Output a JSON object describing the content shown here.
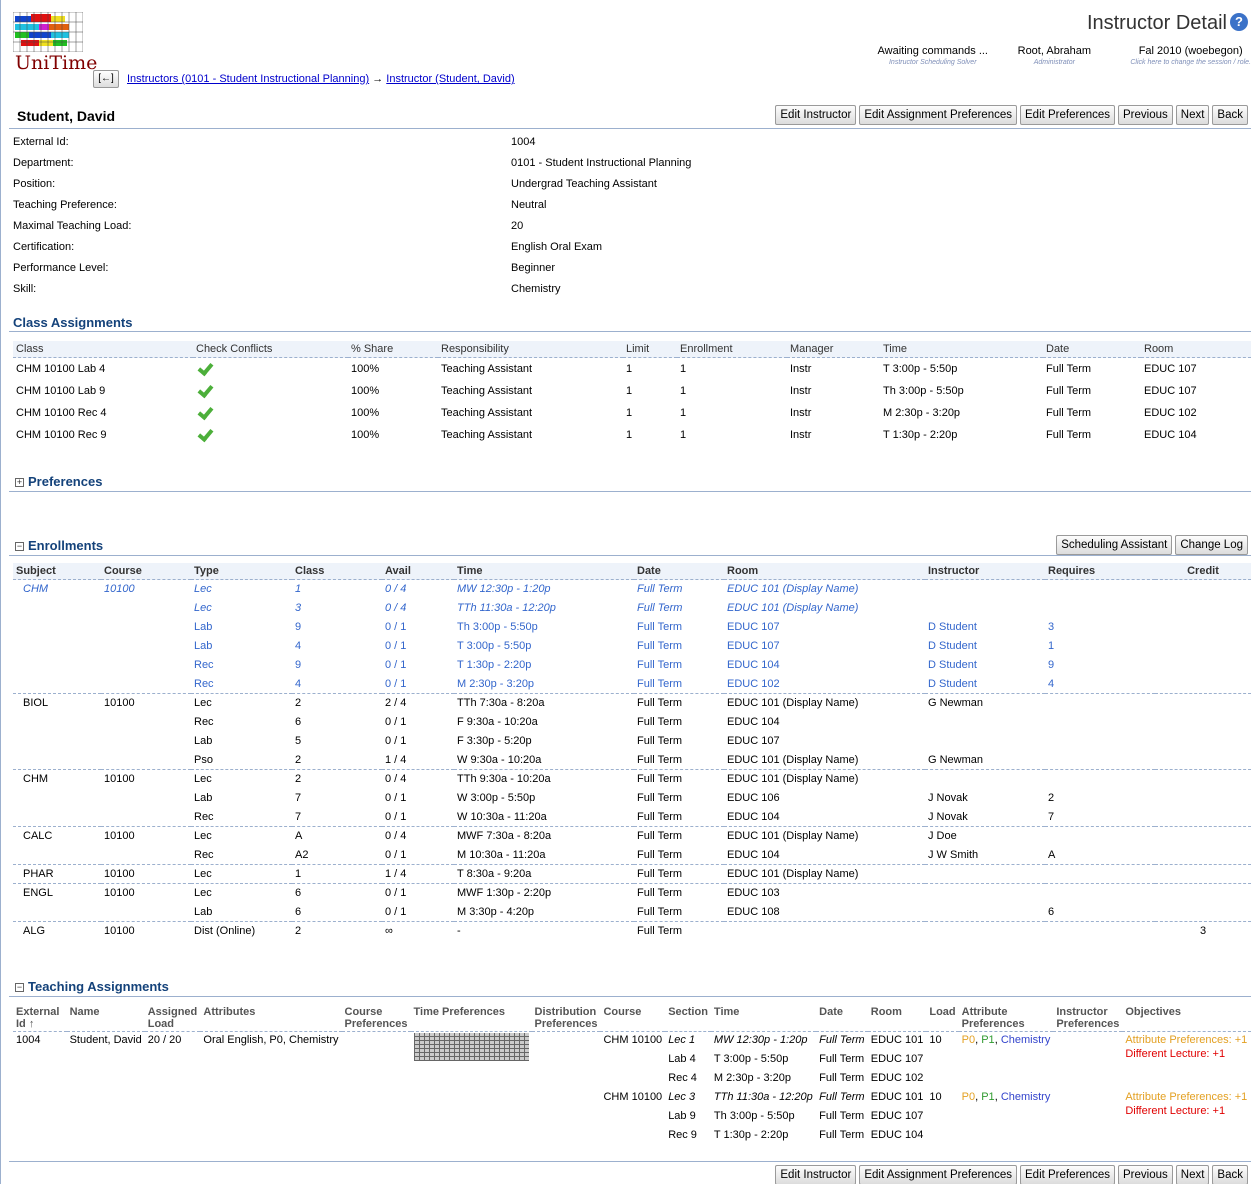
{
  "header": {
    "app_name": "UniTime",
    "title": "Instructor Detail",
    "help_icon": "?",
    "back_arrow": "[←]",
    "breadcrumb": [
      {
        "label": "Instructors (0101 - Student Instructional Planning)"
      },
      {
        "label": "Instructor (Student, David)"
      }
    ],
    "breadcrumb_sep": "→",
    "status": {
      "label": "Awaiting commands ...",
      "sub": "Instructor Scheduling Solver"
    },
    "user": {
      "label": "Root, Abraham",
      "sub": "Administrator"
    },
    "session": {
      "label": "Fal 2010 (woebegon)",
      "sub": "Click here to change the session / role."
    }
  },
  "buttons": {
    "edit_instructor": "Edit Instructor",
    "edit_assignment_prefs": "Edit Assignment Preferences",
    "edit_prefs": "Edit Preferences",
    "previous": "Previous",
    "next": "Next",
    "back": "Back"
  },
  "instructor": {
    "name": "Student, David",
    "fields": [
      {
        "label": "External Id:",
        "value": "1004"
      },
      {
        "label": "Department:",
        "value": "0101 - Student Instructional Planning"
      },
      {
        "label": "Position:",
        "value": "Undergrad Teaching Assistant"
      },
      {
        "label": "Teaching Preference:",
        "value": "Neutral"
      },
      {
        "label": "Maximal Teaching Load:",
        "value": "20"
      },
      {
        "label": "Certification:",
        "value": "English Oral Exam"
      },
      {
        "label": "Performance Level:",
        "value": "Beginner"
      },
      {
        "label": "Skill:",
        "value": "Chemistry"
      }
    ]
  },
  "class_assignments": {
    "title": "Class Assignments",
    "columns": [
      "Class",
      "Check Conflicts",
      "% Share",
      "Responsibility",
      "Limit",
      "Enrollment",
      "Manager",
      "Time",
      "Date",
      "Room"
    ],
    "rows": [
      [
        "CHM 10100 Lab 4",
        "",
        "100%",
        "Teaching Assistant",
        "1",
        "1",
        "Instr",
        "T 3:00p - 5:50p",
        "Full Term",
        "EDUC 107"
      ],
      [
        "CHM 10100 Lab 9",
        "",
        "100%",
        "Teaching Assistant",
        "1",
        "1",
        "Instr",
        "Th 3:00p - 5:50p",
        "Full Term",
        "EDUC 107"
      ],
      [
        "CHM 10100 Rec 4",
        "",
        "100%",
        "Teaching Assistant",
        "1",
        "1",
        "Instr",
        "M 2:30p - 3:20p",
        "Full Term",
        "EDUC 102"
      ],
      [
        "CHM 10100 Rec 9",
        "",
        "100%",
        "Teaching Assistant",
        "1",
        "1",
        "Instr",
        "T 1:30p - 2:20p",
        "Full Term",
        "EDUC 104"
      ]
    ]
  },
  "preferences": {
    "title": "Preferences",
    "toggle": "+"
  },
  "enrollments": {
    "title": "Enrollments",
    "toggle": "−",
    "scheduling_assistant": "Scheduling Assistant",
    "change_log": "Change Log",
    "columns": [
      "Subject",
      "Course",
      "Type",
      "Class",
      "Avail",
      "Time",
      "Date",
      "Room",
      "Instructor",
      "Requires",
      "Credit"
    ],
    "rows": [
      [
        "CHM",
        "10100",
        "Lec",
        "1",
        "0 / 4",
        "MW 12:30p - 1:20p",
        "Full Term",
        "EDUC 101 (Display Name)",
        "",
        "",
        ""
      ],
      [
        "",
        "",
        "Lec",
        "3",
        "0 / 4",
        "TTh 11:30a - 12:20p",
        "Full Term",
        "EDUC 101 (Display Name)",
        "",
        "",
        ""
      ],
      [
        "",
        "",
        "Lab",
        "9",
        "0 / 1",
        "Th 3:00p - 5:50p",
        "Full Term",
        "EDUC 107",
        "D Student",
        "3",
        ""
      ],
      [
        "",
        "",
        "Lab",
        "4",
        "0 / 1",
        "T 3:00p - 5:50p",
        "Full Term",
        "EDUC 107",
        "D Student",
        "1",
        ""
      ],
      [
        "",
        "",
        "Rec",
        "9",
        "0 / 1",
        "T 1:30p - 2:20p",
        "Full Term",
        "EDUC 104",
        "D Student",
        "9",
        ""
      ],
      [
        "",
        "",
        "Rec",
        "4",
        "0 / 1",
        "M 2:30p - 3:20p",
        "Full Term",
        "EDUC 102",
        "D Student",
        "4",
        ""
      ],
      [
        "BIOL",
        "10100",
        "Lec",
        "2",
        "2 / 4",
        "TTh 7:30a - 8:20a",
        "Full Term",
        "EDUC 101 (Display Name)",
        "G Newman",
        "",
        ""
      ],
      [
        "",
        "",
        "Rec",
        "6",
        "0 / 1",
        "F 9:30a - 10:20a",
        "Full Term",
        "EDUC 104",
        "",
        "",
        ""
      ],
      [
        "",
        "",
        "Lab",
        "5",
        "0 / 1",
        "F 3:30p - 5:20p",
        "Full Term",
        "EDUC 107",
        "",
        "",
        ""
      ],
      [
        "",
        "",
        "Pso",
        "2",
        "1 / 4",
        "W 9:30a - 10:20a",
        "Full Term",
        "EDUC 101 (Display Name)",
        "G Newman",
        "",
        ""
      ],
      [
        "CHM",
        "10100",
        "Lec",
        "2",
        "0 / 4",
        "TTh 9:30a - 10:20a",
        "Full Term",
        "EDUC 101 (Display Name)",
        "",
        "",
        ""
      ],
      [
        "",
        "",
        "Lab",
        "7",
        "0 / 1",
        "W 3:00p - 5:50p",
        "Full Term",
        "EDUC 106",
        "J Novak",
        "2",
        ""
      ],
      [
        "",
        "",
        "Rec",
        "7",
        "0 / 1",
        "W 10:30a - 11:20a",
        "Full Term",
        "EDUC 104",
        "J Novak",
        "7",
        ""
      ],
      [
        "CALC",
        "10100",
        "Lec",
        "A",
        "0 / 4",
        "MWF 7:30a - 8:20a",
        "Full Term",
        "EDUC 101 (Display Name)",
        "J Doe",
        "",
        ""
      ],
      [
        "",
        "",
        "Rec",
        "A2",
        "0 / 1",
        "M 10:30a - 11:20a",
        "Full Term",
        "EDUC 104",
        "J W Smith",
        "A",
        ""
      ],
      [
        "PHAR",
        "10100",
        "Lec",
        "1",
        "1 / 4",
        "T 8:30a - 9:20a",
        "Full Term",
        "EDUC 101 (Display Name)",
        "",
        "",
        ""
      ],
      [
        "ENGL",
        "10100",
        "Lec",
        "6",
        "0 / 1",
        "MWF 1:30p - 2:20p",
        "Full Term",
        "EDUC 103",
        "",
        "",
        ""
      ],
      [
        "",
        "",
        "Lab",
        "6",
        "0 / 1",
        "M 3:30p - 4:20p",
        "Full Term",
        "EDUC 108",
        "",
        "6",
        ""
      ],
      [
        "ALG",
        "10100",
        "Dist (Online)",
        "2",
        "∞",
        "-",
        "Full Term",
        "",
        "",
        "",
        "3"
      ]
    ]
  },
  "teaching_assignments": {
    "title": "Teaching Assignments",
    "toggle": "−",
    "columns": [
      "External Id ↑",
      "Name",
      "Assigned Load",
      "Attributes",
      "Course Preferences",
      "Time Preferences",
      "Distribution Preferences",
      "Course",
      "Section",
      "Time",
      "Date",
      "Room",
      "Load",
      "Attribute Preferences",
      "Instructor Preferences",
      "Objectives"
    ],
    "instructor": {
      "external_id": "1004",
      "name": "Student, David",
      "assigned_load": "20 / 20",
      "attributes": "Oral English, P0, Chemistry"
    },
    "assignments": [
      {
        "course": "CHM 10100",
        "load": "10",
        "sections": [
          {
            "section": "Lec 1",
            "time": "MW 12:30p - 1:20p",
            "date": "Full Term",
            "room": "EDUC 101",
            "italic": true
          },
          {
            "section": "Lab 4",
            "time": "T 3:00p - 5:50p",
            "date": "Full Term",
            "room": "EDUC 107"
          },
          {
            "section": "Rec 4",
            "time": "M 2:30p - 3:20p",
            "date": "Full Term",
            "room": "EDUC 102"
          }
        ],
        "attr_prefs": [
          "P0",
          ", ",
          "P1",
          ", ",
          "Chemistry"
        ],
        "objectives": [
          "Attribute Preferences: +1",
          "Different Lecture: +1"
        ]
      },
      {
        "course": "CHM 10100",
        "load": "10",
        "sections": [
          {
            "section": "Lec 3",
            "time": "TTh 11:30a - 12:20p",
            "date": "Full Term",
            "room": "EDUC 101",
            "italic": true
          },
          {
            "section": "Lab 9",
            "time": "Th 3:00p - 5:50p",
            "date": "Full Term",
            "room": "EDUC 107"
          },
          {
            "section": "Rec 9",
            "time": "T 1:30p - 2:20p",
            "date": "Full Term",
            "room": "EDUC 104"
          }
        ],
        "attr_prefs": [
          "P0",
          ", ",
          "P1",
          ", ",
          "Chemistry"
        ],
        "objectives": [
          "Attribute Preferences: +1",
          "Different Lecture: +1"
        ]
      }
    ]
  },
  "colors": {
    "link": "#0000cc",
    "current_row": "#3366cc",
    "section_border": "#9cb0ce",
    "pref_orange": "#e3a022",
    "pref_green": "#2f9a2f",
    "pref_blue": "#3344cc",
    "objective_red": "#e00000"
  }
}
